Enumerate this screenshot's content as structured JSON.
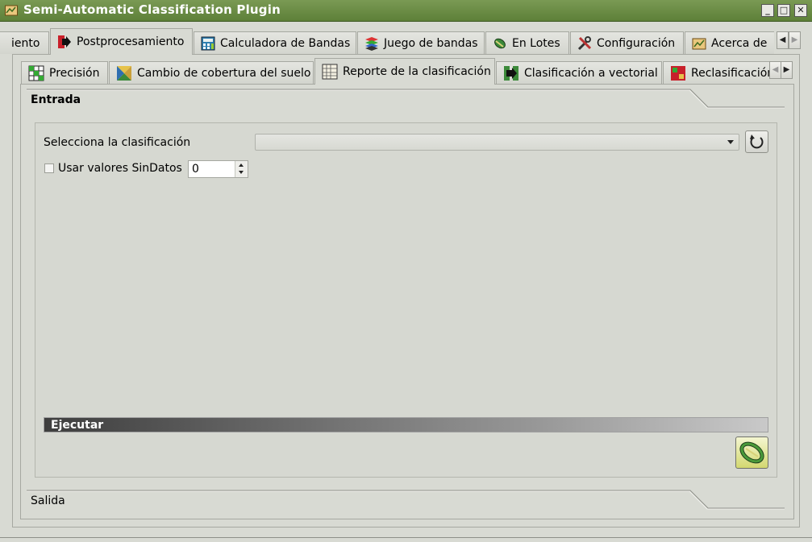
{
  "window": {
    "title": "Semi-Automatic Classification Plugin",
    "buttons": {
      "minimize": "_",
      "maximize": "□",
      "close": "✕"
    }
  },
  "main_tabs": [
    {
      "label": "iento",
      "icon": "partial-tab"
    },
    {
      "label": "Postprocesamiento",
      "icon": "postprocessing-icon",
      "active": true
    },
    {
      "label": "Calculadora de Bandas",
      "icon": "band-calc-icon"
    },
    {
      "label": "Juego de bandas",
      "icon": "band-set-icon"
    },
    {
      "label": "En Lotes",
      "icon": "batch-icon"
    },
    {
      "label": "Configuración",
      "icon": "settings-icon"
    },
    {
      "label": "Acerca de",
      "icon": "about-icon"
    }
  ],
  "sub_tabs": [
    {
      "label": "Precisión",
      "icon": "accuracy-icon"
    },
    {
      "label": "Cambio de cobertura del suelo",
      "icon": "land-cover-change-icon"
    },
    {
      "label": "Reporte de la clasificación",
      "icon": "classification-report-icon",
      "active": true
    },
    {
      "label": "Clasificación a vectorial",
      "icon": "classification-to-vector-icon"
    },
    {
      "label": "Reclasificación",
      "icon": "reclassification-icon"
    }
  ],
  "input_section": {
    "title": "Entrada"
  },
  "form": {
    "select_label": "Selecciona la clasificación",
    "select_value": "",
    "nodata_label": "Usar valores SinDatos",
    "nodata_checked": false,
    "nodata_value": "0"
  },
  "run": {
    "label": "Ejecutar"
  },
  "output_section": {
    "title": "Salida"
  },
  "colors": {
    "titlebar": "#6a8c44",
    "background": "#d8dad3",
    "run_bar_start": "#3e3e3e",
    "run_bar_end": "#c9c9c9"
  }
}
